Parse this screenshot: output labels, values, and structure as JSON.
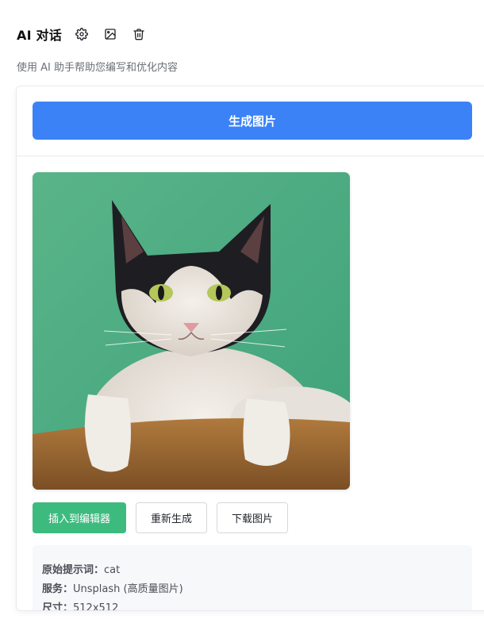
{
  "header": {
    "title": "AI 对话",
    "subtitle": "使用 AI 助手帮助您编写和优化内容",
    "icons": [
      "gear-icon",
      "image-icon",
      "trash-icon"
    ]
  },
  "panel": {
    "generate_label": "生成图片",
    "image_subject": "cat",
    "actions": {
      "insert_label": "插入到编辑器",
      "regenerate_label": "重新生成",
      "download_label": "下载图片"
    },
    "info": {
      "prompt_key": "原始提示词：",
      "prompt_value": "cat",
      "service_key": "服务：",
      "service_value": "Unsplash (高质量图片)",
      "size_key": "尺寸：",
      "size_value": "512x512"
    }
  },
  "colors": {
    "primary_blue": "#3b82f6",
    "insert_green": "#3dbb7f",
    "info_bg": "#f7f8fa"
  }
}
